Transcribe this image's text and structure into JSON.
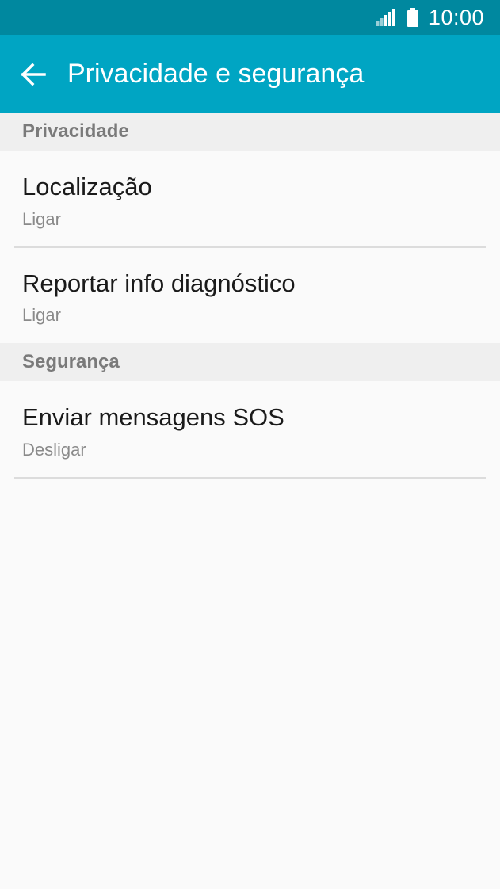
{
  "status_bar": {
    "time": "10:00",
    "icons": [
      "signal-icon",
      "battery-icon"
    ]
  },
  "app_bar": {
    "title": "Privacidade e segurança",
    "back_icon": "back-arrow-icon"
  },
  "sections": [
    {
      "header": "Privacidade",
      "items": [
        {
          "title": "Localização",
          "subtitle": "Ligar"
        },
        {
          "title": "Reportar info diagnóstico",
          "subtitle": "Ligar"
        }
      ]
    },
    {
      "header": "Segurança",
      "items": [
        {
          "title": "Enviar mensagens SOS",
          "subtitle": "Desligar"
        }
      ]
    }
  ],
  "colors": {
    "status_bar": "#00889f",
    "app_bar": "#00a5c3",
    "section_header_bg": "#efefef",
    "section_header_text": "#7a7a7a",
    "background": "#fafafa"
  }
}
